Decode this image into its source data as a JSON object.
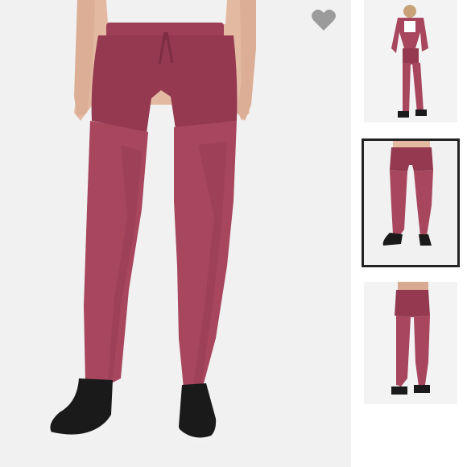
{
  "gallery": {
    "favorite_icon": "heart-icon",
    "product_color": "#a8465e",
    "thumbnails": [
      {
        "name": "full-outfit-view",
        "selected": false
      },
      {
        "name": "front-view",
        "selected": true
      },
      {
        "name": "back-view",
        "selected": false
      }
    ]
  }
}
